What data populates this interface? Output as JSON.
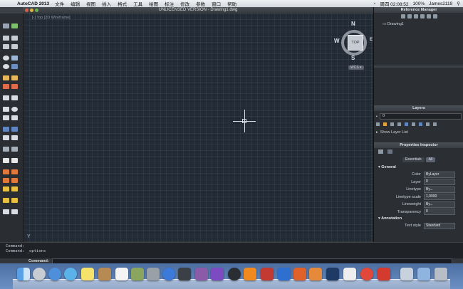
{
  "menubar": {
    "app_name": "AutoCAD 2013",
    "items": [
      "文件",
      "编辑",
      "视图",
      "插入",
      "格式",
      "工具",
      "绘图",
      "标注",
      "修改",
      "参数",
      "窗口",
      "帮助"
    ],
    "status": {
      "clock": "周四 02:08:52",
      "battery": "100%",
      "user": "James2119"
    }
  },
  "window": {
    "title": "UNLICENSED VERSION - Drawing1.dwg"
  },
  "viewport": {
    "label": "[-] Top [2D Wireframe]",
    "ucs_label": "Y"
  },
  "viewcube": {
    "north": "N",
    "south": "S",
    "east": "E",
    "west": "W",
    "face": "TOP",
    "wcs": "WCS ▾"
  },
  "reference_manager": {
    "title": "Reference Manager",
    "item": "Drawing1"
  },
  "layers": {
    "title": "Layers",
    "current_layer": "0",
    "show_list_label": "Show Layer List"
  },
  "properties": {
    "title": "Properties Inspector",
    "tabs": [
      "Essentials",
      "All"
    ],
    "active_tab": "All",
    "sections": {
      "general": "General",
      "annotation": "Annotation"
    },
    "rows": {
      "color": {
        "label": "Color",
        "value": "ByLayer"
      },
      "layer": {
        "label": "Layer",
        "value": "0"
      },
      "linetype": {
        "label": "Linetype",
        "value": "By..."
      },
      "linetype_scale": {
        "label": "Linetype scale",
        "value": "1.0000"
      },
      "lineweight": {
        "label": "Lineweight",
        "value": "By..."
      },
      "transparency": {
        "label": "Transparency",
        "value": "0"
      },
      "text_style": {
        "label": "Text style",
        "value": "Standard"
      }
    }
  },
  "command": {
    "history": [
      "Command:",
      "Command: _options"
    ],
    "prompt_label": "Command:"
  },
  "colors": {
    "canvas": "#222a35",
    "panel": "#2b2f34",
    "dock": "#5a7db2"
  }
}
